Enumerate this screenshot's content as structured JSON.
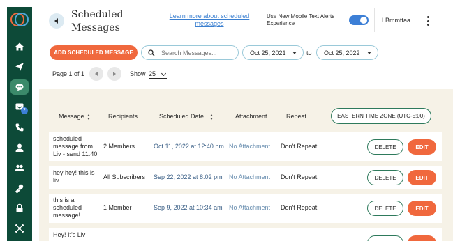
{
  "header": {
    "title": "Scheduled Messages",
    "learn_link": "Learn more about scheduled messages",
    "toggle_label": "Use New Mobile Text Alerts Experience",
    "toggle_on": true,
    "username": "LBmmttaa"
  },
  "sidebar": {
    "badge_count": "2",
    "items": [
      {
        "icon": "home-icon"
      },
      {
        "icon": "send-icon"
      },
      {
        "icon": "chat-icon",
        "active": true
      },
      {
        "icon": "inbox-icon"
      },
      {
        "icon": "phone-icon"
      },
      {
        "icon": "user-icon"
      },
      {
        "icon": "group-icon"
      },
      {
        "icon": "key-icon"
      },
      {
        "icon": "lock-icon"
      },
      {
        "icon": "integrations-icon"
      }
    ]
  },
  "controls": {
    "add_button": "ADD SCHEDULED MESSAGE",
    "search_placeholder": "Search Messages...",
    "date_from": "Oct 25, 2021",
    "date_to_label": "to",
    "date_to": "Oct 25, 2022",
    "page_of": "Page 1 of 1",
    "show_label": "Show",
    "show_value": "25"
  },
  "table": {
    "headers": {
      "message": "Message",
      "recipients": "Recipients",
      "scheduled_date": "Scheduled Date",
      "attachment": "Attachment",
      "repeat": "Repeat"
    },
    "timezone_button": "EASTERN TIME ZONE (UTC-5:00)",
    "delete_label": "DELETE",
    "edit_label": "EDIT",
    "rows": [
      {
        "message": "scheduled message from Liv - send 11:40",
        "recipients": "2 Members",
        "date": "Oct 11, 2022 at 12:40 pm",
        "attachment": "No Attachment",
        "repeat": "Don't Repeat"
      },
      {
        "message": "hey hey! this is liv",
        "recipients": "All Subscribers",
        "date": "Sep 22, 2022 at 8:02 pm",
        "attachment": "No Attachment",
        "repeat": "Don't Repeat"
      },
      {
        "message": "this is a scheduled message!",
        "recipients": "1 Member",
        "date": "Sep 9, 2022 at 10:34 am",
        "attachment": "No Attachment",
        "repeat": "Don't Repeat"
      },
      {
        "message": "Hey! It's Liv",
        "recipients": "",
        "date": "",
        "attachment": "",
        "repeat": ""
      }
    ]
  },
  "colors": {
    "sidebar": "#0d4a38",
    "accent_orange": "#f0683d",
    "accent_blue": "#3c7fd6",
    "table_bg": "#f6f2e7"
  }
}
